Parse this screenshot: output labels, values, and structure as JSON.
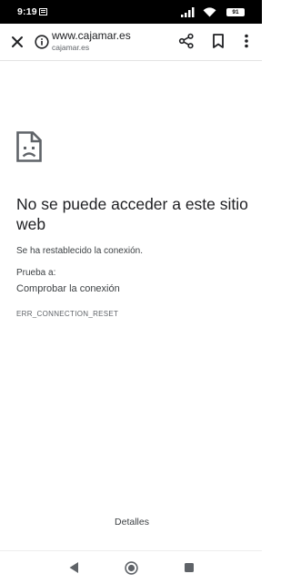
{
  "status_bar": {
    "time": "9:19",
    "battery": "91"
  },
  "toolbar": {
    "url_title": "www.cajamar.es",
    "url_domain": "cajamar.es",
    "icons": [
      "close-icon",
      "info-icon",
      "share-icon",
      "bookmark-icon",
      "more-vert-icon"
    ]
  },
  "error": {
    "icon": "sad-document-icon",
    "title": "No se puede acceder a este sitio web",
    "body": "Se ha restablecido la conexión.",
    "try_label": "Prueba a:",
    "check_connection": "Comprobar la conexión",
    "code": "ERR_CONNECTION_RESET",
    "details_label": "Detalles"
  },
  "nav_bar": {
    "icons": [
      "back-icon",
      "home-icon",
      "recents-icon"
    ]
  }
}
